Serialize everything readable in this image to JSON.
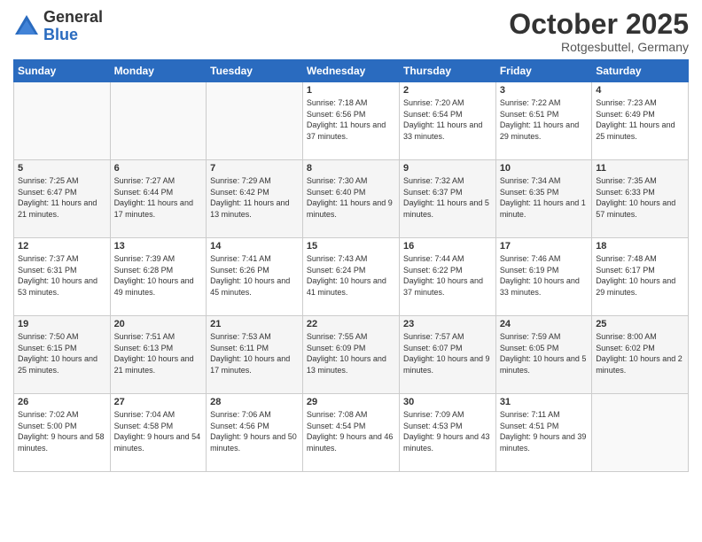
{
  "header": {
    "logo_general": "General",
    "logo_blue": "Blue",
    "month_title": "October 2025",
    "location": "Rotgesbuttel, Germany"
  },
  "weekdays": [
    "Sunday",
    "Monday",
    "Tuesday",
    "Wednesday",
    "Thursday",
    "Friday",
    "Saturday"
  ],
  "weeks": [
    [
      {
        "day": "",
        "sunrise": "",
        "sunset": "",
        "daylight": ""
      },
      {
        "day": "",
        "sunrise": "",
        "sunset": "",
        "daylight": ""
      },
      {
        "day": "",
        "sunrise": "",
        "sunset": "",
        "daylight": ""
      },
      {
        "day": "1",
        "sunrise": "Sunrise: 7:18 AM",
        "sunset": "Sunset: 6:56 PM",
        "daylight": "Daylight: 11 hours and 37 minutes."
      },
      {
        "day": "2",
        "sunrise": "Sunrise: 7:20 AM",
        "sunset": "Sunset: 6:54 PM",
        "daylight": "Daylight: 11 hours and 33 minutes."
      },
      {
        "day": "3",
        "sunrise": "Sunrise: 7:22 AM",
        "sunset": "Sunset: 6:51 PM",
        "daylight": "Daylight: 11 hours and 29 minutes."
      },
      {
        "day": "4",
        "sunrise": "Sunrise: 7:23 AM",
        "sunset": "Sunset: 6:49 PM",
        "daylight": "Daylight: 11 hours and 25 minutes."
      }
    ],
    [
      {
        "day": "5",
        "sunrise": "Sunrise: 7:25 AM",
        "sunset": "Sunset: 6:47 PM",
        "daylight": "Daylight: 11 hours and 21 minutes."
      },
      {
        "day": "6",
        "sunrise": "Sunrise: 7:27 AM",
        "sunset": "Sunset: 6:44 PM",
        "daylight": "Daylight: 11 hours and 17 minutes."
      },
      {
        "day": "7",
        "sunrise": "Sunrise: 7:29 AM",
        "sunset": "Sunset: 6:42 PM",
        "daylight": "Daylight: 11 hours and 13 minutes."
      },
      {
        "day": "8",
        "sunrise": "Sunrise: 7:30 AM",
        "sunset": "Sunset: 6:40 PM",
        "daylight": "Daylight: 11 hours and 9 minutes."
      },
      {
        "day": "9",
        "sunrise": "Sunrise: 7:32 AM",
        "sunset": "Sunset: 6:37 PM",
        "daylight": "Daylight: 11 hours and 5 minutes."
      },
      {
        "day": "10",
        "sunrise": "Sunrise: 7:34 AM",
        "sunset": "Sunset: 6:35 PM",
        "daylight": "Daylight: 11 hours and 1 minute."
      },
      {
        "day": "11",
        "sunrise": "Sunrise: 7:35 AM",
        "sunset": "Sunset: 6:33 PM",
        "daylight": "Daylight: 10 hours and 57 minutes."
      }
    ],
    [
      {
        "day": "12",
        "sunrise": "Sunrise: 7:37 AM",
        "sunset": "Sunset: 6:31 PM",
        "daylight": "Daylight: 10 hours and 53 minutes."
      },
      {
        "day": "13",
        "sunrise": "Sunrise: 7:39 AM",
        "sunset": "Sunset: 6:28 PM",
        "daylight": "Daylight: 10 hours and 49 minutes."
      },
      {
        "day": "14",
        "sunrise": "Sunrise: 7:41 AM",
        "sunset": "Sunset: 6:26 PM",
        "daylight": "Daylight: 10 hours and 45 minutes."
      },
      {
        "day": "15",
        "sunrise": "Sunrise: 7:43 AM",
        "sunset": "Sunset: 6:24 PM",
        "daylight": "Daylight: 10 hours and 41 minutes."
      },
      {
        "day": "16",
        "sunrise": "Sunrise: 7:44 AM",
        "sunset": "Sunset: 6:22 PM",
        "daylight": "Daylight: 10 hours and 37 minutes."
      },
      {
        "day": "17",
        "sunrise": "Sunrise: 7:46 AM",
        "sunset": "Sunset: 6:19 PM",
        "daylight": "Daylight: 10 hours and 33 minutes."
      },
      {
        "day": "18",
        "sunrise": "Sunrise: 7:48 AM",
        "sunset": "Sunset: 6:17 PM",
        "daylight": "Daylight: 10 hours and 29 minutes."
      }
    ],
    [
      {
        "day": "19",
        "sunrise": "Sunrise: 7:50 AM",
        "sunset": "Sunset: 6:15 PM",
        "daylight": "Daylight: 10 hours and 25 minutes."
      },
      {
        "day": "20",
        "sunrise": "Sunrise: 7:51 AM",
        "sunset": "Sunset: 6:13 PM",
        "daylight": "Daylight: 10 hours and 21 minutes."
      },
      {
        "day": "21",
        "sunrise": "Sunrise: 7:53 AM",
        "sunset": "Sunset: 6:11 PM",
        "daylight": "Daylight: 10 hours and 17 minutes."
      },
      {
        "day": "22",
        "sunrise": "Sunrise: 7:55 AM",
        "sunset": "Sunset: 6:09 PM",
        "daylight": "Daylight: 10 hours and 13 minutes."
      },
      {
        "day": "23",
        "sunrise": "Sunrise: 7:57 AM",
        "sunset": "Sunset: 6:07 PM",
        "daylight": "Daylight: 10 hours and 9 minutes."
      },
      {
        "day": "24",
        "sunrise": "Sunrise: 7:59 AM",
        "sunset": "Sunset: 6:05 PM",
        "daylight": "Daylight: 10 hours and 5 minutes."
      },
      {
        "day": "25",
        "sunrise": "Sunrise: 8:00 AM",
        "sunset": "Sunset: 6:02 PM",
        "daylight": "Daylight: 10 hours and 2 minutes."
      }
    ],
    [
      {
        "day": "26",
        "sunrise": "Sunrise: 7:02 AM",
        "sunset": "Sunset: 5:00 PM",
        "daylight": "Daylight: 9 hours and 58 minutes."
      },
      {
        "day": "27",
        "sunrise": "Sunrise: 7:04 AM",
        "sunset": "Sunset: 4:58 PM",
        "daylight": "Daylight: 9 hours and 54 minutes."
      },
      {
        "day": "28",
        "sunrise": "Sunrise: 7:06 AM",
        "sunset": "Sunset: 4:56 PM",
        "daylight": "Daylight: 9 hours and 50 minutes."
      },
      {
        "day": "29",
        "sunrise": "Sunrise: 7:08 AM",
        "sunset": "Sunset: 4:54 PM",
        "daylight": "Daylight: 9 hours and 46 minutes."
      },
      {
        "day": "30",
        "sunrise": "Sunrise: 7:09 AM",
        "sunset": "Sunset: 4:53 PM",
        "daylight": "Daylight: 9 hours and 43 minutes."
      },
      {
        "day": "31",
        "sunrise": "Sunrise: 7:11 AM",
        "sunset": "Sunset: 4:51 PM",
        "daylight": "Daylight: 9 hours and 39 minutes."
      },
      {
        "day": "",
        "sunrise": "",
        "sunset": "",
        "daylight": ""
      }
    ]
  ]
}
